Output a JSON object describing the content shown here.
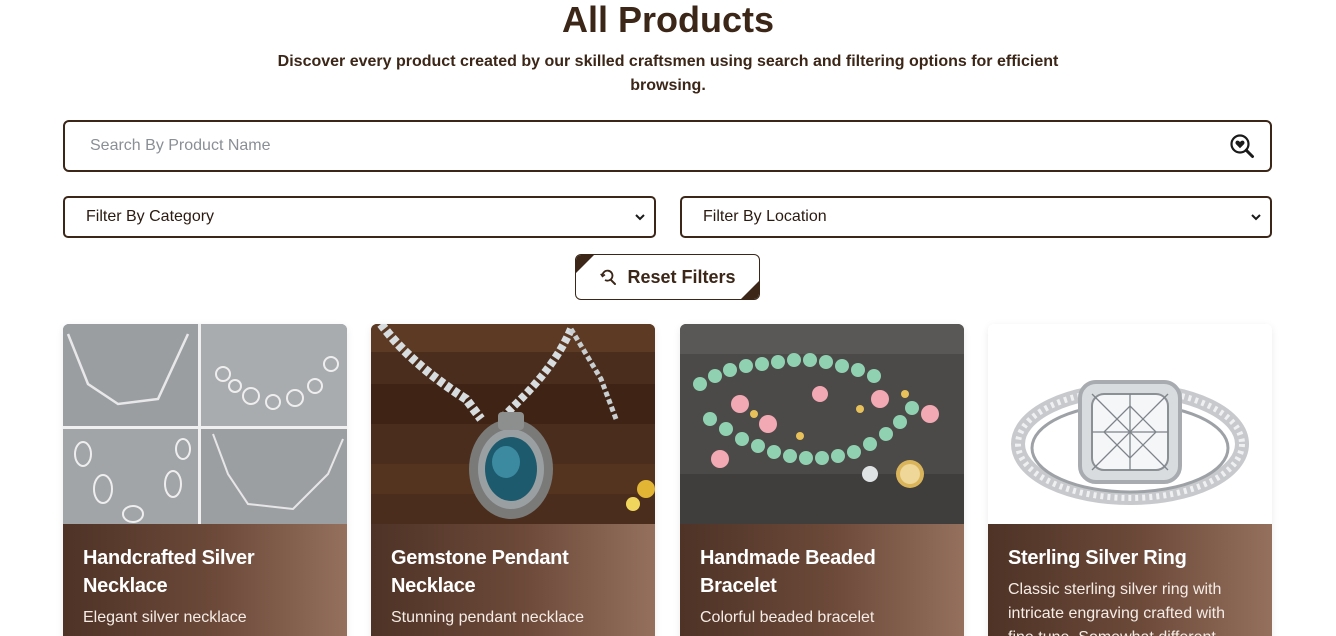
{
  "header": {
    "title": "All Products",
    "subtitle": "Discover every product created by our skilled craftsmen using search and filtering options for efficient browsing."
  },
  "search": {
    "placeholder": "Search By Product Name",
    "value": "",
    "icon": "search-heart-icon"
  },
  "filters": {
    "category_selected": "Filter By Category",
    "location_selected": "Filter By Location",
    "reset_label": "Reset Filters",
    "reset_icon": "refresh-search-icon"
  },
  "colors": {
    "primary": "#3b2618",
    "card_gradient_start": "#4e3326",
    "card_gradient_end": "#94705d"
  },
  "products": [
    {
      "title": "Handcrafted Silver Necklace",
      "description": "Elegant silver necklace"
    },
    {
      "title": "Gemstone Pendant Necklace",
      "description": "Stunning pendant necklace"
    },
    {
      "title": "Handmade Beaded Bracelet",
      "description": "Colorful beaded bracelet"
    },
    {
      "title": "Sterling Silver Ring",
      "description": "Classic sterling silver ring with intricate engraving crafted with fine tune. Somewhat different"
    }
  ]
}
